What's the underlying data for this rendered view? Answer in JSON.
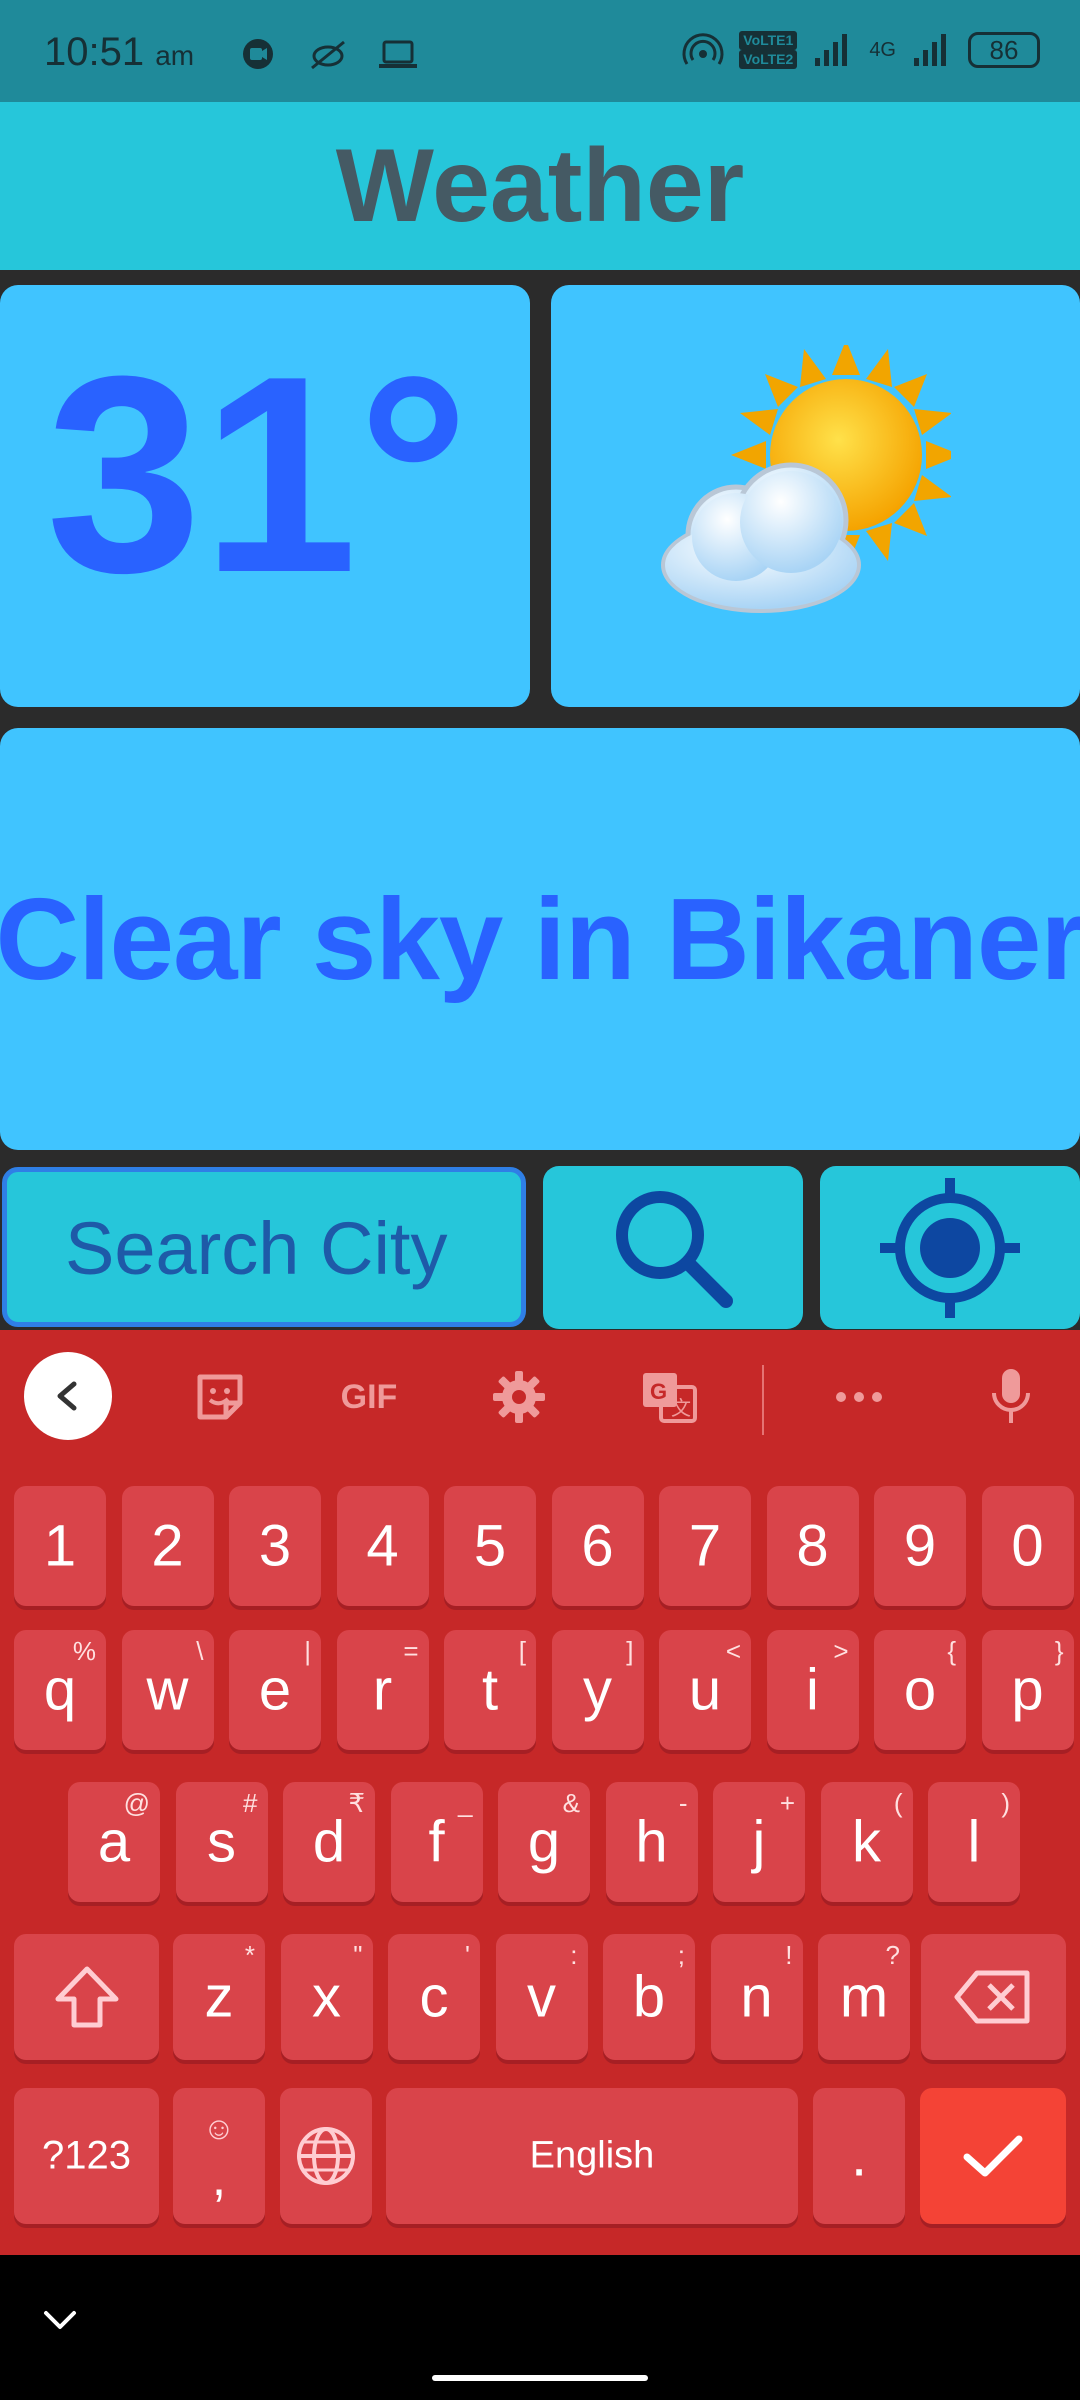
{
  "status_bar": {
    "time": "10:51",
    "ampm": "am",
    "battery": "86",
    "network_label": "4G",
    "sim1": "1",
    "sim2": "2"
  },
  "app": {
    "title": "Weather"
  },
  "weather": {
    "temperature": "31°",
    "description": "Clear sky in Bikaner",
    "icon": "sun-behind-cloud-icon"
  },
  "search": {
    "placeholder": "Search City",
    "value": ""
  },
  "keyboard": {
    "number_row": [
      "1",
      "2",
      "3",
      "4",
      "5",
      "6",
      "7",
      "8",
      "9",
      "0"
    ],
    "row1": [
      {
        "key": "q",
        "alt": "%"
      },
      {
        "key": "w",
        "alt": "\\"
      },
      {
        "key": "e",
        "alt": "|"
      },
      {
        "key": "r",
        "alt": "="
      },
      {
        "key": "t",
        "alt": "["
      },
      {
        "key": "y",
        "alt": "]"
      },
      {
        "key": "u",
        "alt": "<"
      },
      {
        "key": "i",
        "alt": ">"
      },
      {
        "key": "o",
        "alt": "{"
      },
      {
        "key": "p",
        "alt": "}"
      }
    ],
    "row2": [
      {
        "key": "a",
        "alt": "@"
      },
      {
        "key": "s",
        "alt": "#"
      },
      {
        "key": "d",
        "alt": "₹"
      },
      {
        "key": "f",
        "alt": "_"
      },
      {
        "key": "g",
        "alt": "&"
      },
      {
        "key": "h",
        "alt": "-"
      },
      {
        "key": "j",
        "alt": "+"
      },
      {
        "key": "k",
        "alt": "("
      },
      {
        "key": "l",
        "alt": ")"
      }
    ],
    "row3": [
      {
        "key": "z",
        "alt": "*"
      },
      {
        "key": "x",
        "alt": "\""
      },
      {
        "key": "c",
        "alt": "'"
      },
      {
        "key": "v",
        "alt": ":"
      },
      {
        "key": "b",
        "alt": ";"
      },
      {
        "key": "n",
        "alt": "!"
      },
      {
        "key": "m",
        "alt": "?"
      }
    ],
    "symbols_label": "?123",
    "comma_label": ",",
    "space_label": "English",
    "period_label": ".",
    "gif_label": "GIF"
  }
}
